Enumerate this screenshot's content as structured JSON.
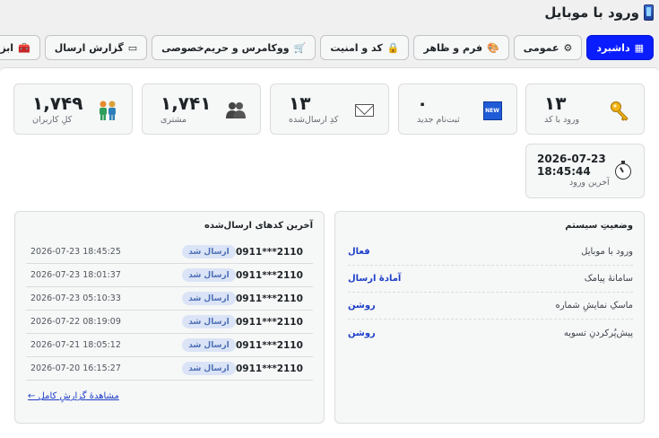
{
  "header": {
    "title": "ورود با موبایل",
    "icon": "mobile-phone-icon"
  },
  "tabs": [
    {
      "label": "داشبرد",
      "icon": "▦",
      "active": true
    },
    {
      "label": "عمومی",
      "icon": "⚙",
      "active": false
    },
    {
      "label": "فرم و ظاهر",
      "icon": "🎨",
      "active": false
    },
    {
      "label": "کد و امنیت",
      "icon": "🔒",
      "active": false
    },
    {
      "label": "ووکامرس و حریم‌خصوصی",
      "icon": "🛒",
      "active": false
    },
    {
      "label": "گزارش ارسال",
      "icon": "▭",
      "active": false
    },
    {
      "label": "ابزارها",
      "icon": "🧰",
      "active": false
    }
  ],
  "stats": [
    {
      "value": "۱۳",
      "label": "ورود با کد",
      "icon": "key-icon"
    },
    {
      "value": "۰",
      "label": "ثبت‌نام جدید",
      "icon": "new-badge-icon",
      "badge": "NEW"
    },
    {
      "value": "۱۳",
      "label": "کدِ ارسال‌شده",
      "icon": "envelope-icon"
    },
    {
      "value": "۱,۷۴۱",
      "label": "مشتری",
      "icon": "customers-icon"
    },
    {
      "value": "۱,۷۴۹",
      "label": "کلِ کاربران",
      "icon": "users-icon"
    }
  ],
  "last_login": {
    "datetime": "2026-07-23\n18:45:44",
    "label": "آخرین ورود",
    "icon": "stopwatch-icon"
  },
  "system_status": {
    "title": "وضعیتِ سیستم",
    "rows": [
      {
        "label": "ورود با موبایل",
        "value": "فعال"
      },
      {
        "label": "سامانهٔ پیامک",
        "value": "آمادهٔ ارسال"
      },
      {
        "label": "ماسکِ نمایشِ شماره",
        "value": "روشن"
      },
      {
        "label": "پیش‌پُرکردنِ تسویه",
        "value": "روشن"
      }
    ]
  },
  "recent_codes": {
    "title": "آخرین کدهای ارسال‌شده",
    "rows": [
      {
        "phone": "0911***2110",
        "status": "ارسال شد",
        "time": "2026-07-23 18:45:25"
      },
      {
        "phone": "0911***2110",
        "status": "ارسال شد",
        "time": "2026-07-23 18:01:37"
      },
      {
        "phone": "0911***2110",
        "status": "ارسال شد",
        "time": "2026-07-23 05:10:33"
      },
      {
        "phone": "0911***2110",
        "status": "ارسال شد",
        "time": "2026-07-22 08:19:09"
      },
      {
        "phone": "0911***2110",
        "status": "ارسال شد",
        "time": "2026-07-21 18:05:12"
      },
      {
        "phone": "0911***2110",
        "status": "ارسال شد",
        "time": "2026-07-20 16:15:27"
      }
    ],
    "more_link": "مشاهدهٔ گزارشِ کامل ←"
  },
  "colors": {
    "accent": "#0a1dff",
    "link": "#1d3fc8",
    "badge_bg": "#dbe4f6"
  }
}
